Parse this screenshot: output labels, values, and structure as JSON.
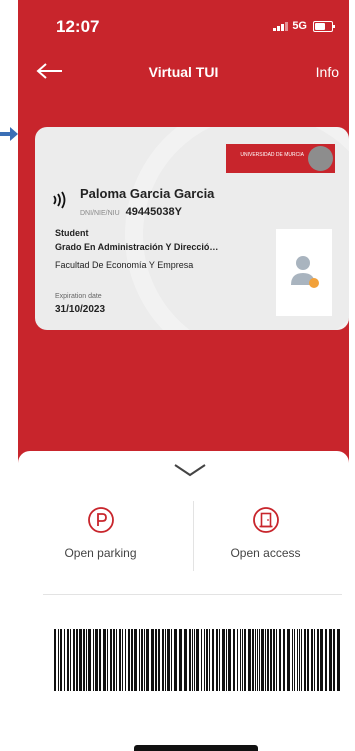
{
  "status_bar": {
    "time": "12:07",
    "network": "5G"
  },
  "header": {
    "title": "Virtual TUI",
    "info_label": "Info"
  },
  "card": {
    "university_name": "UNIVERSIDAD DE MURCIA",
    "holder_name": "Paloma Garcia Garcia",
    "id_label": "DNI/NIE/NIU",
    "id_value": "49445038Y",
    "role": "Student",
    "degree": "Grado En Administración Y Direcció…",
    "faculty": "Facultad De Economía Y Empresa",
    "expiration_label": "Expiration date",
    "expiration_date": "31/10/2023"
  },
  "actions": {
    "parking_label": "Open parking",
    "access_label": "Open access"
  },
  "colors": {
    "brand_red": "#c8252c",
    "pointer_arrow": "#3b6fb6"
  },
  "icons": [
    "back-arrow-icon",
    "nfc-icon",
    "avatar-placeholder-icon",
    "chevron-down-icon",
    "parking-icon",
    "door-icon"
  ]
}
